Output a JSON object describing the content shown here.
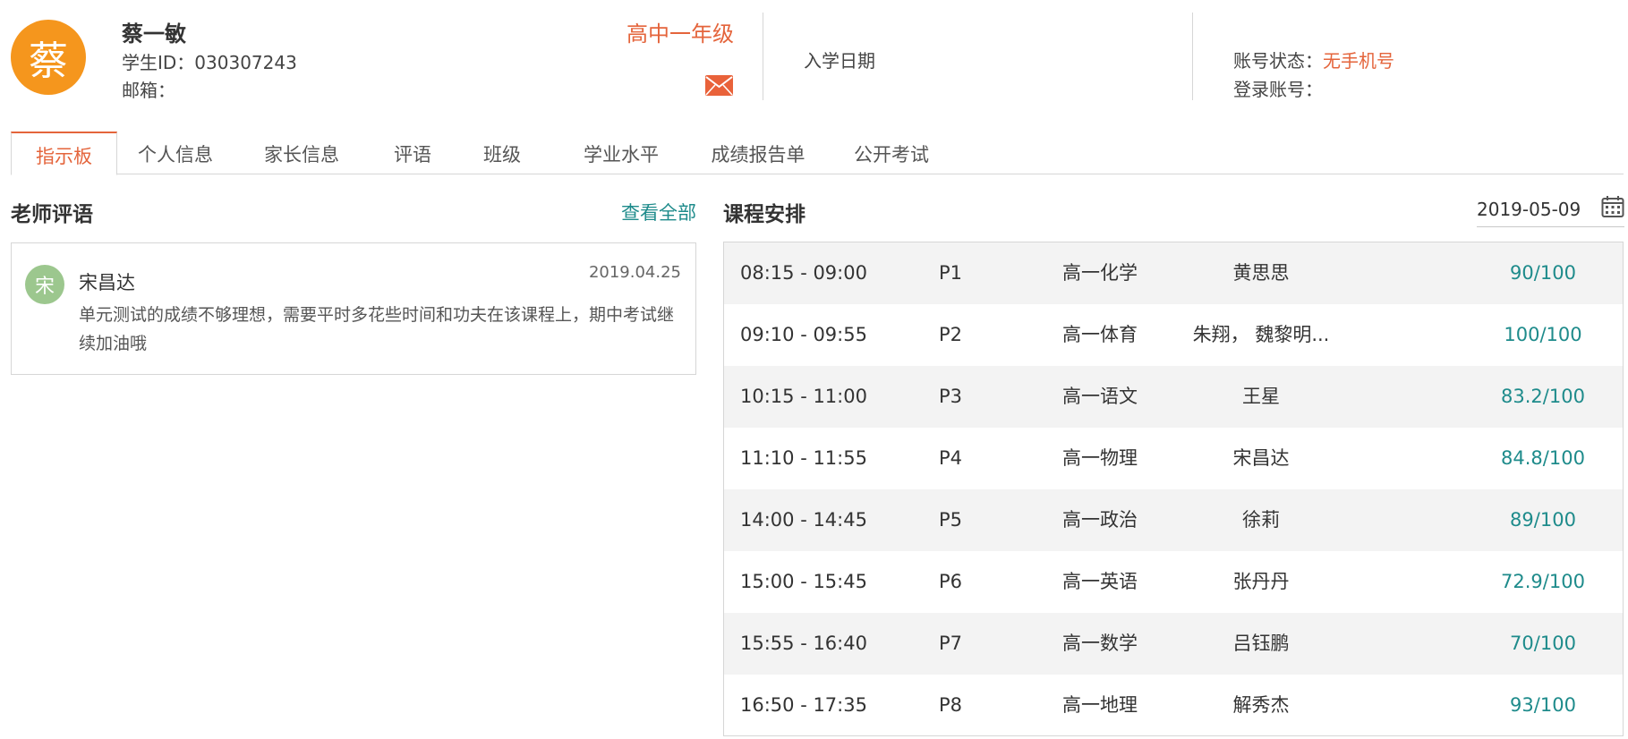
{
  "student": {
    "avatar_char": "蔡",
    "name": "蔡一敏",
    "id_line": "学生ID：030307243",
    "email_line": "邮箱：",
    "grade": "高中一年级"
  },
  "enrollment": {
    "label": "入学日期"
  },
  "account": {
    "status_label": "账号状态：",
    "status_value": "无手机号",
    "login_label": "登录账号："
  },
  "tabs": [
    {
      "label": "指示板",
      "active": true
    },
    {
      "label": "个人信息"
    },
    {
      "label": "家长信息"
    },
    {
      "label": "评语"
    },
    {
      "label": "班级"
    },
    {
      "label": "学业水平"
    },
    {
      "label": "成绩报告单"
    },
    {
      "label": "公开考试"
    }
  ],
  "comments": {
    "title": "老师评语",
    "view_all": "查看全部",
    "items": [
      {
        "avatar_char": "宋",
        "teacher": "宋昌达",
        "date": "2019.04.25",
        "text": "单元测试的成绩不够理想，需要平时多花些时间和功夫在该课程上，期中考试继续加油哦"
      }
    ]
  },
  "schedule": {
    "title": "课程安排",
    "date": "2019-05-09",
    "rows": [
      {
        "time": "08:15 - 09:00",
        "period": "P1",
        "subject": "高一化学",
        "teacher": "黄思思",
        "score": "90/100"
      },
      {
        "time": "09:10 - 09:55",
        "period": "P2",
        "subject": "高一体育",
        "teacher": "朱翔， 魏黎明...",
        "score": "100/100"
      },
      {
        "time": "10:15 - 11:00",
        "period": "P3",
        "subject": "高一语文",
        "teacher": "王星",
        "score": "83.2/100"
      },
      {
        "time": "11:10 - 11:55",
        "period": "P4",
        "subject": "高一物理",
        "teacher": "宋昌达",
        "score": "84.8/100"
      },
      {
        "time": "14:00 - 14:45",
        "period": "P5",
        "subject": "高一政治",
        "teacher": "徐莉",
        "score": "89/100"
      },
      {
        "time": "15:00 - 15:45",
        "period": "P6",
        "subject": "高一英语",
        "teacher": "张丹丹",
        "score": "72.9/100"
      },
      {
        "time": "15:55 - 16:40",
        "period": "P7",
        "subject": "高一数学",
        "teacher": "吕钰鹏",
        "score": "70/100"
      },
      {
        "time": "16:50 - 17:35",
        "period": "P8",
        "subject": "高一地理",
        "teacher": "解秀杰",
        "score": "93/100"
      }
    ]
  },
  "colors": {
    "accent": "#e4643b",
    "avatar": "#f5961d",
    "teal": "#1e8b8b",
    "comment_avatar": "#9cc78e"
  },
  "icons": {
    "mail": "mail-icon",
    "calendar": "calendar-icon"
  }
}
